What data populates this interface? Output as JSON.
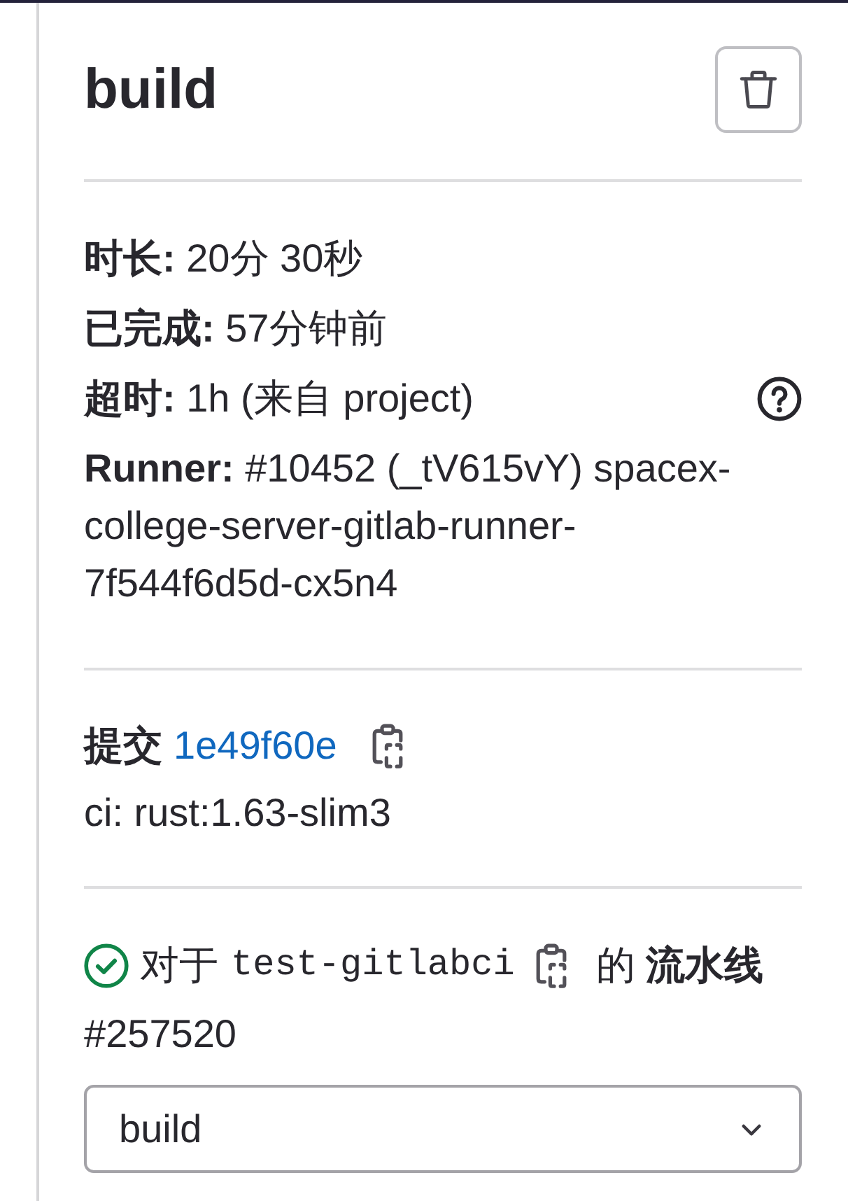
{
  "job": {
    "title": "build"
  },
  "details": [
    {
      "text": "**时长:** 20分 30秒",
      "help": false
    },
    {
      "text": "**已完成:** 57分钟前",
      "help": false
    },
    {
      "text": "**超时:** 1h (来自 project)",
      "help": true
    },
    {
      "text": "**Runner:** #10452 (_tV615vY) spacex-college-server-gitlab-runner-7f544f6d5d-cx5n4",
      "help": false
    }
  ],
  "commit": {
    "label": "提交",
    "sha": "1e49f60e",
    "message": "ci: rust:1.63-slim3"
  },
  "pipeline": {
    "passed": true,
    "prefix": "对于",
    "ref": "test-gitlabci",
    "suffix": "的 **流水线**",
    "id": "#257520"
  },
  "stage_dropdown": {
    "value": "build"
  }
}
